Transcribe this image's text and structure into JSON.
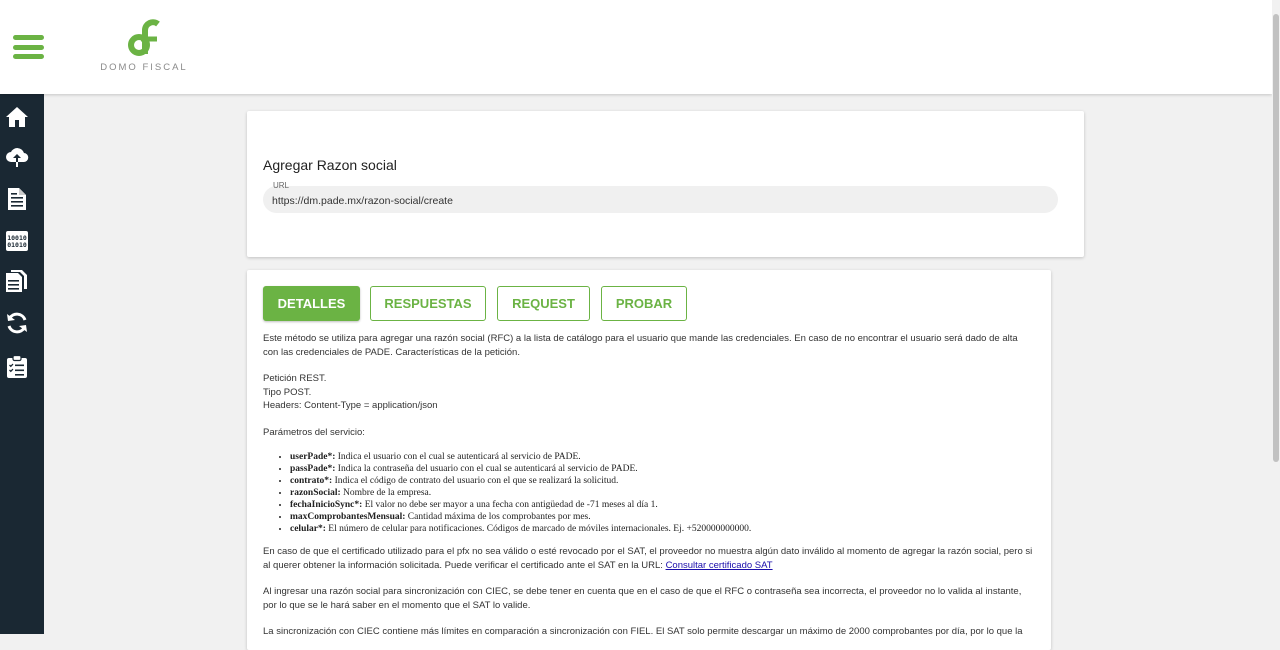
{
  "brand": {
    "logo_text": "DOMO FISCAL",
    "accent_color": "#6bb344",
    "sidebar_color": "#1a2833"
  },
  "sidebar": {
    "icons": [
      "home-icon",
      "cloud-upload-icon",
      "document-icon",
      "binary-icon",
      "documents-icon",
      "sync-icon",
      "clipboard-list-icon"
    ]
  },
  "endpoint": {
    "title": "Agregar Razon social",
    "url_label": "URL",
    "url_value": "https://dm.pade.mx/razon-social/create"
  },
  "tabs": [
    {
      "label": "DETALLES",
      "active": true
    },
    {
      "label": "RESPUESTAS",
      "active": false
    },
    {
      "label": "REQUEST",
      "active": false
    },
    {
      "label": "PROBAR",
      "active": false
    }
  ],
  "details": {
    "intro": "Este método se utiliza para agregar una razón social (RFC) a la lista de catálogo para el usuario que mande las credenciales. En caso de no encontrar el usuario será dado de alta con las credenciales de PADE. Características de la petición.",
    "request_lines": [
      "Petición REST.",
      "Tipo POST.",
      "Headers: Content-Type = application/json"
    ],
    "params_heading": "Parámetros del servicio:",
    "params": [
      {
        "name": "userPade*:",
        "desc": " Indica el usuario con el cual se autenticará al servicio de PADE."
      },
      {
        "name": "passPade*:",
        "desc": " Indica la contraseña del usuario con el cual se autenticará al servicio de PADE."
      },
      {
        "name": "contrato*:",
        "desc": " Indica el código de contrato del usuario con el que se realizará la solicitud."
      },
      {
        "name": "razonSocial:",
        "desc": " Nombre de la empresa."
      },
      {
        "name": "fechaInicioSync*:",
        "desc": " El valor no debe ser mayor a una fecha con antigüedad de -71 meses al día 1."
      },
      {
        "name": "maxComprobantesMensual:",
        "desc": " Cantidad máxima de los comprobantes por mes."
      },
      {
        "name": "celular*:",
        "desc": " El número de celular para notificaciones. Códigos de marcado de móviles internacionales. Ej. +520000000000."
      }
    ],
    "note1": "En caso de que el certificado utilizado para el pfx no sea válido o esté revocado por el SAT, el proveedor no muestra algún dato inválido al momento de agregar la razón social, pero si al querer obtener la información solicitada. Puede verificar el certificado ante el SAT en la URL: ",
    "note1_link": "Consultar certificado SAT",
    "note2": "Al ingresar una razón social para sincronización con CIEC, se debe tener en cuenta que en el caso de que el RFC o contraseña sea incorrecta, el proveedor no lo valida al instante, por lo que se le hará saber en el momento que el SAT lo valide.",
    "note3": "La sincronización con CIEC contiene más límites en comparación a sincronización con FIEL. El SAT solo permite descargar un máximo de 2000 comprobantes por día, por lo que la"
  }
}
